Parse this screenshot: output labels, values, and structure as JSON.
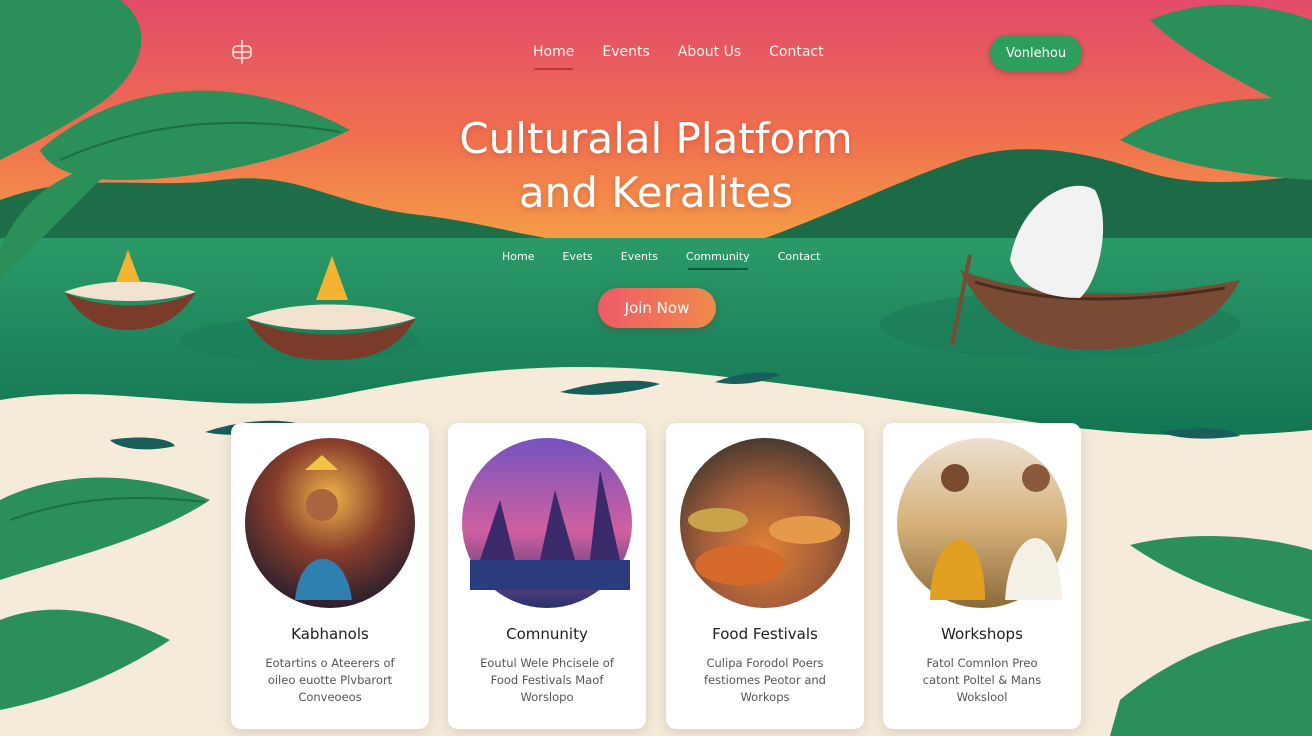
{
  "nav": {
    "items": [
      {
        "label": "Home",
        "active": true
      },
      {
        "label": "Events",
        "active": false
      },
      {
        "label": "About Us",
        "active": false
      },
      {
        "label": "Contact",
        "active": false
      }
    ],
    "cta_label": "Vonlehou"
  },
  "hero": {
    "title_line1": "Culturalal Platform",
    "title_line2": "and Keralites",
    "subnav": [
      {
        "label": "Home",
        "active": false
      },
      {
        "label": "Evets",
        "active": false
      },
      {
        "label": "Events",
        "active": false
      },
      {
        "label": "Community",
        "active": true
      },
      {
        "label": "Contact",
        "active": false
      }
    ],
    "join_label": "Join Now"
  },
  "cards": [
    {
      "title": "Kabhanols",
      "lines": [
        "Eotartins o Ateerers of",
        "oileo euotte Plvbarort",
        "Conveoeos"
      ]
    },
    {
      "title": "Comnunity",
      "lines": [
        "Eoutul Wele Phcisele of",
        "Food Festivals Maof",
        "Worslopo"
      ]
    },
    {
      "title": "Food Festivals",
      "lines": [
        "Culipa Forodol Poers",
        "festiomes Peotor and",
        "Workops"
      ]
    },
    {
      "title": "Workshops",
      "lines": [
        "Fatol Comnlon Preo",
        "catont Poltel & Mans",
        "Wokslool"
      ]
    }
  ],
  "icons": {
    "logo": "lotus-logo-icon",
    "card_images": [
      "festival-people-photo",
      "temple-at-dusk-photo",
      "food-thalis-photo",
      "two-men-meeting-photo"
    ]
  },
  "colors": {
    "accent_green": "#2e9e5c",
    "join_gradient_start": "#ef5b67",
    "join_gradient_end": "#f08a4a",
    "sky_top": "#e44d67",
    "sky_bottom": "#f5944a",
    "water": "#1f8a62",
    "cream": "#f6ead9"
  }
}
